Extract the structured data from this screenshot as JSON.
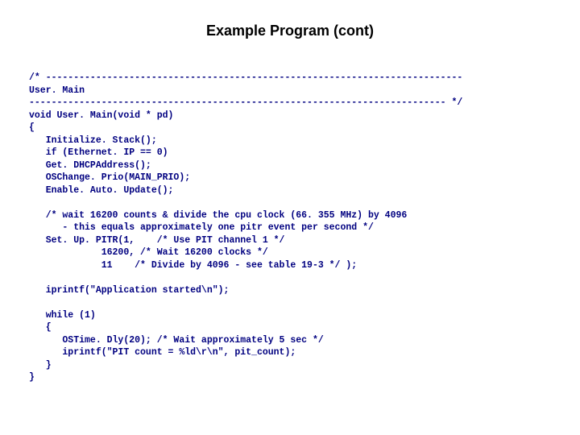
{
  "title": "Example Program (cont)",
  "code": "/* ---------------------------------------------------------------------------\nUser. Main\n--------------------------------------------------------------------------- */\nvoid User. Main(void * pd)\n{\n   Initialize. Stack();\n   if (Ethernet. IP == 0)\n   Get. DHCPAddress();\n   OSChange. Prio(MAIN_PRIO);\n   Enable. Auto. Update();\n\n   /* wait 16200 counts & divide the cpu clock (66. 355 MHz) by 4096\n      - this equals approximately one pitr event per second */\n   Set. Up. PITR(1,    /* Use PIT channel 1 */\n             16200, /* Wait 16200 clocks */\n             11    /* Divide by 4096 - see table 19-3 */ );\n\n   iprintf(\"Application started\\n\");\n\n   while (1)\n   {\n      OSTime. Dly(20); /* Wait approximately 5 sec */\n      iprintf(\"PIT count = %ld\\r\\n\", pit_count);\n   }\n}"
}
